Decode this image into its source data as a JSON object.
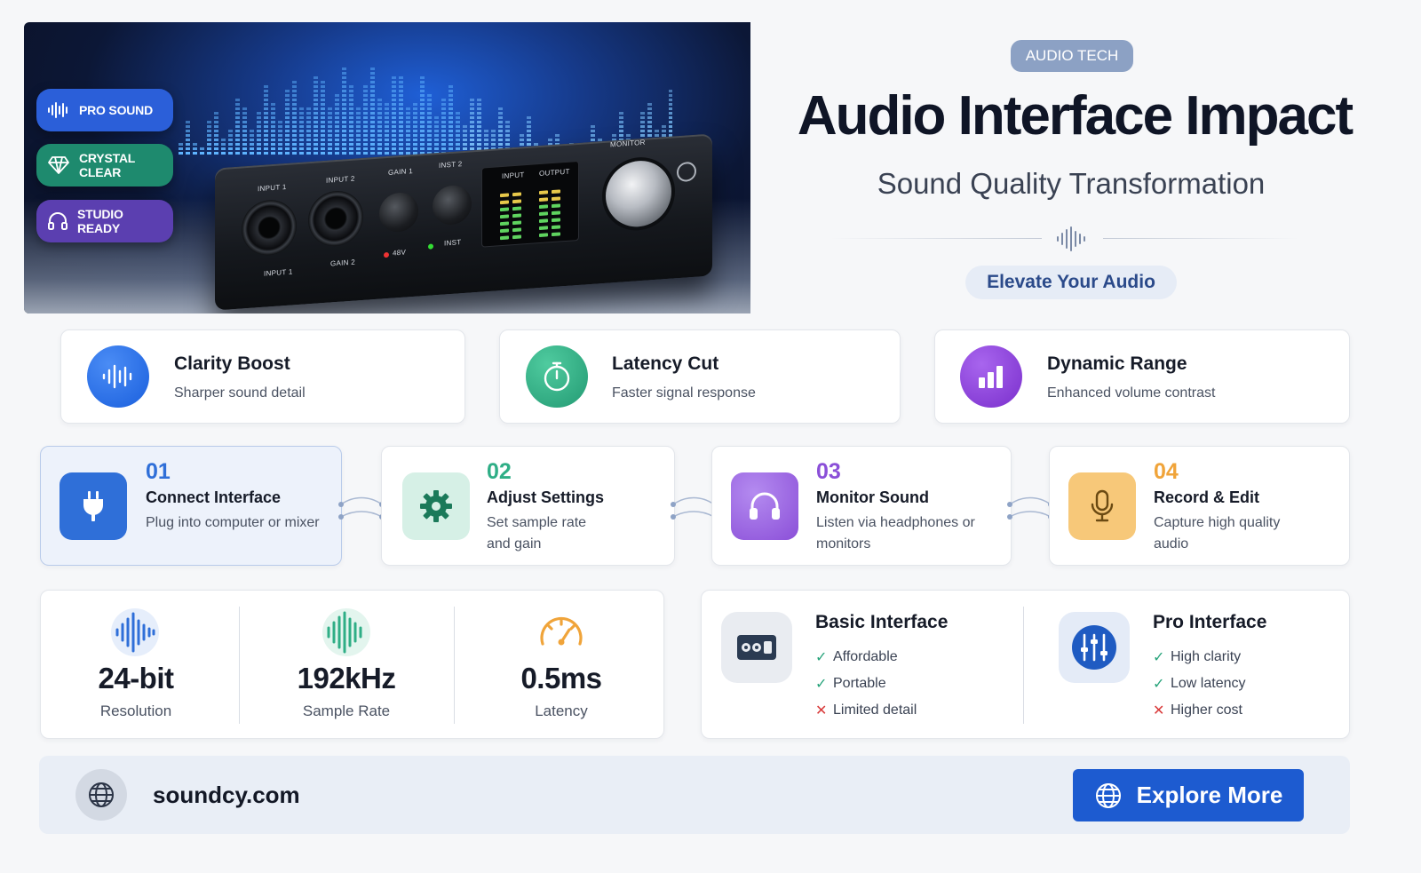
{
  "hero": {
    "badges": [
      {
        "label": "PRO SOUND",
        "icon": "waveform-icon",
        "color": "#2b5fd9"
      },
      {
        "label": "CRYSTAL CLEAR",
        "icon": "diamond-icon",
        "color": "#1e8a6e"
      },
      {
        "label": "STUDIO READY",
        "icon": "headphones-icon",
        "color": "#5b3fb0"
      }
    ],
    "device_labels": {
      "input1": "INPUT 1",
      "input2": "INPUT 2",
      "gain1": "GAIN 1",
      "inst2": "INST 2",
      "input_meter": "INPUT",
      "output_meter": "OUTPUT",
      "monitor": "MONITOR",
      "bottom1": "INPUT 1",
      "bottom2": "GAIN 2",
      "phantom": "48V",
      "inst": "INST"
    }
  },
  "header": {
    "tag": "AUDIO TECH",
    "title": "Audio Interface Impact",
    "subtitle": "Sound Quality Transformation",
    "badge": "Elevate Your Audio"
  },
  "features": [
    {
      "title": "Clarity Boost",
      "desc": "Sharper sound detail",
      "icon": "waveform-icon",
      "color": "#1f6ee8"
    },
    {
      "title": "Latency Cut",
      "desc": "Faster signal response",
      "icon": "stopwatch-icon",
      "color": "#2fae86"
    },
    {
      "title": "Dynamic Range",
      "desc": "Enhanced volume contrast",
      "icon": "bar-chart-icon",
      "color": "#8d3fd8"
    }
  ],
  "steps": [
    {
      "num": "01",
      "title": "Connect Interface",
      "desc": "Plug into computer or mixer",
      "icon": "plug-icon",
      "color": "#2f6fd8"
    },
    {
      "num": "02",
      "title": "Adjust Settings",
      "desc": "Set sample rate and gain",
      "icon": "gear-icon",
      "color": "#2fae86"
    },
    {
      "num": "03",
      "title": "Monitor Sound",
      "desc": "Listen via headphones or monitors",
      "icon": "headphones-icon",
      "color": "#8b4fd8"
    },
    {
      "num": "04",
      "title": "Record & Edit",
      "desc": "Capture high quality audio",
      "icon": "microphone-icon",
      "color": "#f0a43a"
    }
  ],
  "stats": [
    {
      "value": "24-bit",
      "label": "Resolution",
      "icon": "waveform-icon",
      "color": "#2f6fd8"
    },
    {
      "value": "192kHz",
      "label": "Sample Rate",
      "icon": "waveform-icon",
      "color": "#2fae86"
    },
    {
      "value": "0.5ms",
      "label": "Latency",
      "icon": "gauge-icon",
      "color": "#f0a43a"
    }
  ],
  "comparison": [
    {
      "title": "Basic Interface",
      "icon": "interface-box-icon",
      "items": [
        {
          "text": "Affordable",
          "ok": true
        },
        {
          "text": "Portable",
          "ok": true
        },
        {
          "text": "Limited detail",
          "ok": false
        }
      ]
    },
    {
      "title": "Pro Interface",
      "icon": "mixer-sliders-icon",
      "items": [
        {
          "text": "High clarity",
          "ok": true
        },
        {
          "text": "Low latency",
          "ok": true
        },
        {
          "text": "Higher cost",
          "ok": false
        }
      ]
    }
  ],
  "footer": {
    "site": "soundcy.com",
    "cta": "Explore More"
  }
}
